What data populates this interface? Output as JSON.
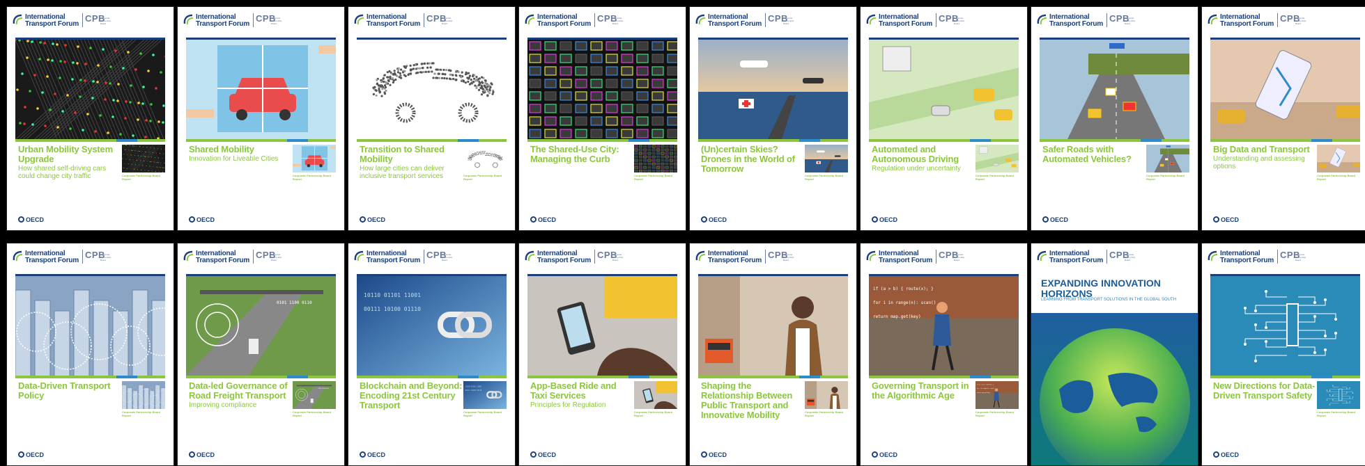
{
  "brand": {
    "itf_line1": "International",
    "itf_line2": "Transport Forum",
    "cpb": "CPB",
    "cpb_sub": "Corporate Partnership Board",
    "oecd": "OECD",
    "report_label": "Corporate Partnership Board Report",
    "green": "#8cc63f",
    "navy": "#1b3f7a",
    "blue": "#2e8bc9"
  },
  "covers": [
    {
      "title": "Urban Mobility System Upgrade",
      "subtitle": "How shared self-driving cars could change city traffic",
      "image_icon": "city-network-map-icon"
    },
    {
      "title": "Shared Mobility",
      "subtitle": "Innovation for Liveable Cities",
      "image_icon": "car-puzzle-icon"
    },
    {
      "title": "Transition to Shared Mobility",
      "subtitle": "How large cities can deliver inclusive transport services",
      "image_icon": "people-forming-car-icon"
    },
    {
      "title": "The Shared-Use City: Managing the Curb",
      "subtitle": "",
      "image_icon": "colored-street-grid-icon"
    },
    {
      "title": "(Un)certain Skies? Drones in the World of Tomorrow",
      "subtitle": "",
      "image_icon": "drones-over-city-icon"
    },
    {
      "title": "Automated and Autonomous Driving",
      "subtitle": "Regulation under uncertainty",
      "image_icon": "automated-street-illustration-icon"
    },
    {
      "title": "Safer Roads with Automated Vehicles?",
      "subtitle": "",
      "image_icon": "highway-sensors-icon"
    },
    {
      "title": "Big Data and Transport",
      "subtitle": "Understanding and assessing options",
      "image_icon": "smartphone-map-icon"
    },
    {
      "title": "Data-Driven Transport Policy",
      "subtitle": "",
      "image_icon": "data-city-icon"
    },
    {
      "title": "Data-led Governance of Road Freight Transport",
      "subtitle": "Improving compliance",
      "image_icon": "freight-road-data-icon"
    },
    {
      "title": "Blockchain and Beyond: Encoding 21st Century Transport",
      "subtitle": "",
      "image_icon": "chain-link-icon"
    },
    {
      "title": "App-Based Ride and Taxi Services",
      "subtitle": "Principles for Regulation",
      "image_icon": "taxi-app-phone-icon"
    },
    {
      "title": "Shaping the Relationship Between Public Transport and Innovative Mobility",
      "subtitle": "",
      "image_icon": "woman-phone-bus-icon"
    },
    {
      "title": "Governing Transport in the Algorithmic Age",
      "subtitle": "",
      "image_icon": "code-street-icon"
    },
    {
      "title": "EXPANDING INNOVATION HORIZONS",
      "subtitle": "LEARNING FROM TRANSPORT SOLUTIONS IN THE GLOBAL SOUTH",
      "image_icon": "globe-icon"
    },
    {
      "title": "New Directions for Data-Driven Transport Safety",
      "subtitle": "",
      "image_icon": "circuit-transport-icon"
    }
  ]
}
